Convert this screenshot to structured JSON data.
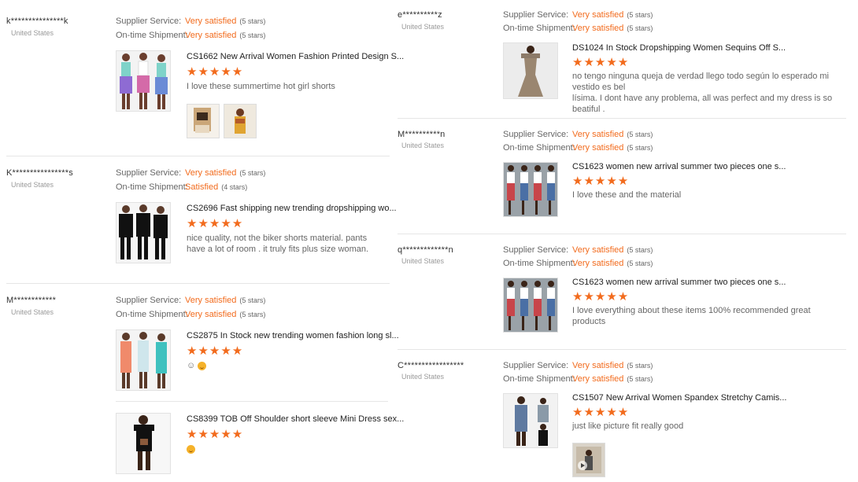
{
  "labels": {
    "supplier": "Supplier Service:",
    "shipment": "On-time Shipment:"
  },
  "left": [
    {
      "user": "k***************k",
      "country": "United States",
      "supplier": {
        "value": "Very satisfied",
        "stars": "(5 stars)"
      },
      "shipment": {
        "value": "Very satisfied",
        "stars": "(5 stars)"
      },
      "products": [
        {
          "title": "CS1662 New Arrival Women Fashion Printed Design S...",
          "comment": "I love these summertime hot girl shorts",
          "rating": 5,
          "photos": 2
        }
      ]
    },
    {
      "user": "K****************s",
      "country": "United States",
      "supplier": {
        "value": "Very satisfied",
        "stars": "(5 stars)"
      },
      "shipment": {
        "value": "Satisfied",
        "stars": "(4 stars)"
      },
      "products": [
        {
          "title": "CS2696 Fast shipping new trending dropshipping wo...",
          "comment": "nice quality, not the biker shorts material. pants\nhave a lot of room . it truly fits plus size woman.",
          "rating": 5
        }
      ]
    },
    {
      "user": "M************",
      "country": "United States",
      "supplier": {
        "value": "Very satisfied",
        "stars": "(5 stars)"
      },
      "shipment": {
        "value": "Very satisfied",
        "stars": "(5 stars)"
      },
      "products": [
        {
          "title": "CS2875 In Stock new trending women fashion long sl...",
          "comment": "☺",
          "rating": 5
        },
        {
          "title": "CS8399 TOB Off Shoulder short sleeve Mini Dress sex...",
          "comment": "",
          "rating": 5
        }
      ]
    }
  ],
  "right": [
    {
      "user": "e**********z",
      "country": "United States",
      "supplier": {
        "value": "Very satisfied",
        "stars": "(5 stars)"
      },
      "shipment": {
        "value": "Very satisfied",
        "stars": "(5 stars)"
      },
      "products": [
        {
          "title": "DS1024 In Stock Dropshipping Women Sequins Off S...",
          "comment": "no tengo ninguna queja de verdad  llego todo según lo esperado mi vestido es bel\nlísima.  I dont have any problema, all was perfect and my dress is so beatiful .",
          "rating": 5
        }
      ]
    },
    {
      "user": "M**********n",
      "country": "United States",
      "supplier": {
        "value": "Very satisfied",
        "stars": "(5 stars)"
      },
      "shipment": {
        "value": "Very satisfied",
        "stars": "(5 stars)"
      },
      "products": [
        {
          "title": "CS1623 women new arrival summer two pieces one s...",
          "comment": "I love these and the material",
          "rating": 5
        }
      ]
    },
    {
      "user": "q*************n",
      "country": "United States",
      "supplier": {
        "value": "Very satisfied",
        "stars": "(5 stars)"
      },
      "shipment": {
        "value": "Very satisfied",
        "stars": "(5 stars)"
      },
      "products": [
        {
          "title": "CS1623 women new arrival summer two pieces one s...",
          "comment": "I love everything about these items 100% recommended great products",
          "rating": 5
        }
      ]
    },
    {
      "user": "C*****************",
      "country": "United States",
      "supplier": {
        "value": "Very satisfied",
        "stars": "(5 stars)"
      },
      "shipment": {
        "value": "Very satisfied",
        "stars": "(5 stars)"
      },
      "products": [
        {
          "title": "CS1507 New Arrival Women Spandex Stretchy Camis...",
          "comment": "just like picture fit really good",
          "rating": 5,
          "photos": 1
        }
      ]
    }
  ],
  "colors": {
    "accent": "#f26b1d",
    "muted": "#999999",
    "separator": "#e6e6e6"
  }
}
